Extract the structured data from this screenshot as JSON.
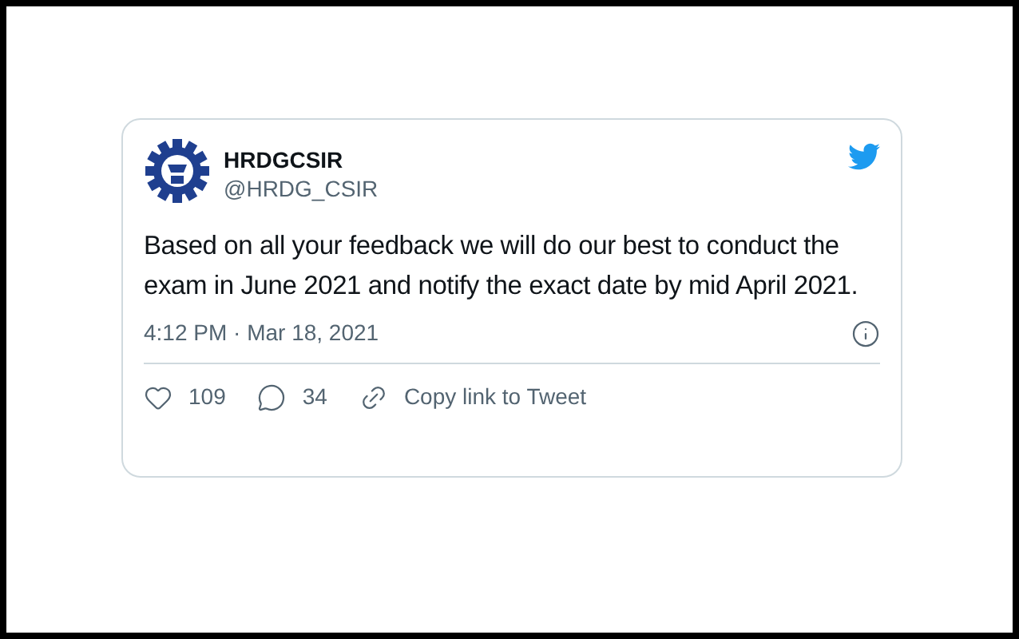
{
  "tweet": {
    "author_name": "HRDGCSIR",
    "handle": "@HRDG_CSIR",
    "text": "Based on all your feedback we will do our best to conduct the exam in June 2021 and notify the exact date by mid April 2021.",
    "timestamp": "4:12 PM · Mar 18, 2021",
    "actions": [
      {
        "kind": "like",
        "label": "109"
      },
      {
        "kind": "reply",
        "label": "34"
      },
      {
        "kind": "copy",
        "label": "Copy link to Tweet"
      }
    ]
  }
}
